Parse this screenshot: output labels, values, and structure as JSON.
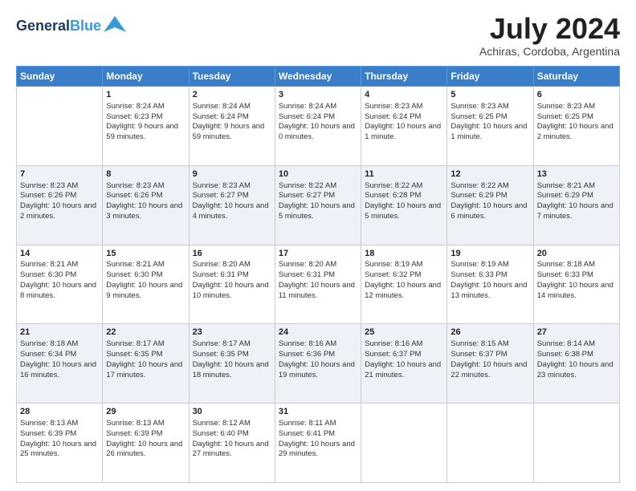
{
  "logo": {
    "text_general": "General",
    "text_blue": "Blue",
    "bird_symbol": "▶"
  },
  "header": {
    "title": "July 2024",
    "subtitle": "Achiras, Cordoba, Argentina"
  },
  "days_of_week": [
    "Sunday",
    "Monday",
    "Tuesday",
    "Wednesday",
    "Thursday",
    "Friday",
    "Saturday"
  ],
  "weeks": [
    [
      {
        "day": "",
        "sunrise": "",
        "sunset": "",
        "daylight": ""
      },
      {
        "day": "1",
        "sunrise": "Sunrise: 8:24 AM",
        "sunset": "Sunset: 6:23 PM",
        "daylight": "Daylight: 9 hours and 59 minutes."
      },
      {
        "day": "2",
        "sunrise": "Sunrise: 8:24 AM",
        "sunset": "Sunset: 6:24 PM",
        "daylight": "Daylight: 9 hours and 59 minutes."
      },
      {
        "day": "3",
        "sunrise": "Sunrise: 8:24 AM",
        "sunset": "Sunset: 6:24 PM",
        "daylight": "Daylight: 10 hours and 0 minutes."
      },
      {
        "day": "4",
        "sunrise": "Sunrise: 8:23 AM",
        "sunset": "Sunset: 6:24 PM",
        "daylight": "Daylight: 10 hours and 1 minute."
      },
      {
        "day": "5",
        "sunrise": "Sunrise: 8:23 AM",
        "sunset": "Sunset: 6:25 PM",
        "daylight": "Daylight: 10 hours and 1 minute."
      },
      {
        "day": "6",
        "sunrise": "Sunrise: 8:23 AM",
        "sunset": "Sunset: 6:25 PM",
        "daylight": "Daylight: 10 hours and 2 minutes."
      }
    ],
    [
      {
        "day": "7",
        "sunrise": "Sunrise: 8:23 AM",
        "sunset": "Sunset: 6:26 PM",
        "daylight": "Daylight: 10 hours and 2 minutes."
      },
      {
        "day": "8",
        "sunrise": "Sunrise: 8:23 AM",
        "sunset": "Sunset: 6:26 PM",
        "daylight": "Daylight: 10 hours and 3 minutes."
      },
      {
        "day": "9",
        "sunrise": "Sunrise: 8:23 AM",
        "sunset": "Sunset: 6:27 PM",
        "daylight": "Daylight: 10 hours and 4 minutes."
      },
      {
        "day": "10",
        "sunrise": "Sunrise: 8:22 AM",
        "sunset": "Sunset: 6:27 PM",
        "daylight": "Daylight: 10 hours and 5 minutes."
      },
      {
        "day": "11",
        "sunrise": "Sunrise: 8:22 AM",
        "sunset": "Sunset: 6:28 PM",
        "daylight": "Daylight: 10 hours and 5 minutes."
      },
      {
        "day": "12",
        "sunrise": "Sunrise: 8:22 AM",
        "sunset": "Sunset: 6:29 PM",
        "daylight": "Daylight: 10 hours and 6 minutes."
      },
      {
        "day": "13",
        "sunrise": "Sunrise: 8:21 AM",
        "sunset": "Sunset: 6:29 PM",
        "daylight": "Daylight: 10 hours and 7 minutes."
      }
    ],
    [
      {
        "day": "14",
        "sunrise": "Sunrise: 8:21 AM",
        "sunset": "Sunset: 6:30 PM",
        "daylight": "Daylight: 10 hours and 8 minutes."
      },
      {
        "day": "15",
        "sunrise": "Sunrise: 8:21 AM",
        "sunset": "Sunset: 6:30 PM",
        "daylight": "Daylight: 10 hours and 9 minutes."
      },
      {
        "day": "16",
        "sunrise": "Sunrise: 8:20 AM",
        "sunset": "Sunset: 6:31 PM",
        "daylight": "Daylight: 10 hours and 10 minutes."
      },
      {
        "day": "17",
        "sunrise": "Sunrise: 8:20 AM",
        "sunset": "Sunset: 6:31 PM",
        "daylight": "Daylight: 10 hours and 11 minutes."
      },
      {
        "day": "18",
        "sunrise": "Sunrise: 8:19 AM",
        "sunset": "Sunset: 6:32 PM",
        "daylight": "Daylight: 10 hours and 12 minutes."
      },
      {
        "day": "19",
        "sunrise": "Sunrise: 8:19 AM",
        "sunset": "Sunset: 6:33 PM",
        "daylight": "Daylight: 10 hours and 13 minutes."
      },
      {
        "day": "20",
        "sunrise": "Sunrise: 8:18 AM",
        "sunset": "Sunset: 6:33 PM",
        "daylight": "Daylight: 10 hours and 14 minutes."
      }
    ],
    [
      {
        "day": "21",
        "sunrise": "Sunrise: 8:18 AM",
        "sunset": "Sunset: 6:34 PM",
        "daylight": "Daylight: 10 hours and 16 minutes."
      },
      {
        "day": "22",
        "sunrise": "Sunrise: 8:17 AM",
        "sunset": "Sunset: 6:35 PM",
        "daylight": "Daylight: 10 hours and 17 minutes."
      },
      {
        "day": "23",
        "sunrise": "Sunrise: 8:17 AM",
        "sunset": "Sunset: 6:35 PM",
        "daylight": "Daylight: 10 hours and 18 minutes."
      },
      {
        "day": "24",
        "sunrise": "Sunrise: 8:16 AM",
        "sunset": "Sunset: 6:36 PM",
        "daylight": "Daylight: 10 hours and 19 minutes."
      },
      {
        "day": "25",
        "sunrise": "Sunrise: 8:16 AM",
        "sunset": "Sunset: 6:37 PM",
        "daylight": "Daylight: 10 hours and 21 minutes."
      },
      {
        "day": "26",
        "sunrise": "Sunrise: 8:15 AM",
        "sunset": "Sunset: 6:37 PM",
        "daylight": "Daylight: 10 hours and 22 minutes."
      },
      {
        "day": "27",
        "sunrise": "Sunrise: 8:14 AM",
        "sunset": "Sunset: 6:38 PM",
        "daylight": "Daylight: 10 hours and 23 minutes."
      }
    ],
    [
      {
        "day": "28",
        "sunrise": "Sunrise: 8:13 AM",
        "sunset": "Sunset: 6:39 PM",
        "daylight": "Daylight: 10 hours and 25 minutes."
      },
      {
        "day": "29",
        "sunrise": "Sunrise: 8:13 AM",
        "sunset": "Sunset: 6:39 PM",
        "daylight": "Daylight: 10 hours and 26 minutes."
      },
      {
        "day": "30",
        "sunrise": "Sunrise: 8:12 AM",
        "sunset": "Sunset: 6:40 PM",
        "daylight": "Daylight: 10 hours and 27 minutes."
      },
      {
        "day": "31",
        "sunrise": "Sunrise: 8:11 AM",
        "sunset": "Sunset: 6:41 PM",
        "daylight": "Daylight: 10 hours and 29 minutes."
      },
      {
        "day": "",
        "sunrise": "",
        "sunset": "",
        "daylight": ""
      },
      {
        "day": "",
        "sunrise": "",
        "sunset": "",
        "daylight": ""
      },
      {
        "day": "",
        "sunrise": "",
        "sunset": "",
        "daylight": ""
      }
    ]
  ]
}
